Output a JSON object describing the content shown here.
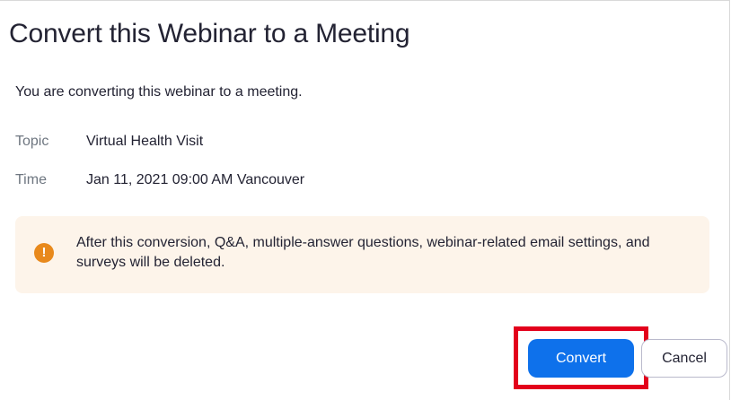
{
  "dialog": {
    "title": "Convert this Webinar to a Meeting",
    "intro": "You are converting this webinar to a meeting."
  },
  "fields": {
    "topic": {
      "label": "Topic",
      "value": "Virtual Health Visit"
    },
    "time": {
      "label": "Time",
      "value": "Jan 11, 2021 09:00 AM Vancouver"
    }
  },
  "warning": {
    "icon": "exclamation-icon",
    "icon_glyph": "!",
    "text": "After this conversion, Q&A, multiple-answer questions, webinar-related email settings, and surveys will be deleted."
  },
  "actions": {
    "convert_label": "Convert",
    "cancel_label": "Cancel"
  },
  "colors": {
    "primary": "#0e71eb",
    "warning_bg": "#fdf4ea",
    "warning_icon": "#e8891c",
    "highlight": "#e3001b"
  }
}
